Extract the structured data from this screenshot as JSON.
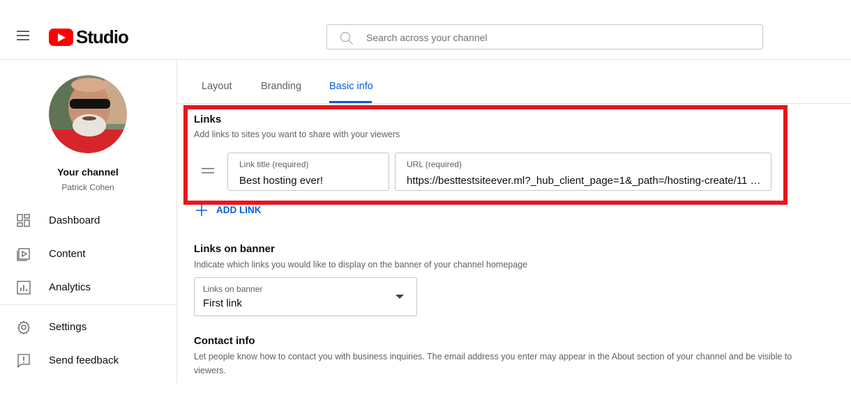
{
  "header": {
    "logo_text": "Studio",
    "search_placeholder": "Search across your channel"
  },
  "sidebar": {
    "channel_label": "Your channel",
    "channel_name": "Patrick Cohen",
    "items": [
      {
        "label": "Dashboard",
        "icon": "dashboard-icon"
      },
      {
        "label": "Content",
        "icon": "content-icon"
      },
      {
        "label": "Analytics",
        "icon": "analytics-icon"
      },
      {
        "label": "Settings",
        "icon": "gear-icon"
      },
      {
        "label": "Send feedback",
        "icon": "feedback-icon"
      }
    ]
  },
  "tabs": [
    {
      "label": "Layout",
      "active": false
    },
    {
      "label": "Branding",
      "active": false
    },
    {
      "label": "Basic info",
      "active": true
    }
  ],
  "links_section": {
    "title": "Links",
    "description": "Add links to sites you want to share with your viewers",
    "link_title_label": "Link title (required)",
    "link_title_value": "Best hosting ever!",
    "url_label": "URL (required)",
    "url_value": "https://besttestsiteever.ml?_hub_client_page=1&_path=/hosting-create/11 …",
    "add_link_label": "ADD LINK"
  },
  "banner_section": {
    "title": "Links on banner",
    "description": "Indicate which links you would like to display on the banner of your channel homepage",
    "dropdown_label": "Links on banner",
    "dropdown_value": "First link"
  },
  "contact_section": {
    "title": "Contact info",
    "description": "Let people know how to contact you with business inquiries. The email address you enter may appear in the About section of your channel and be visible to viewers."
  },
  "colors": {
    "accent": "#065fd4",
    "highlight": "#e8151c",
    "brand_red": "#ff0000"
  }
}
